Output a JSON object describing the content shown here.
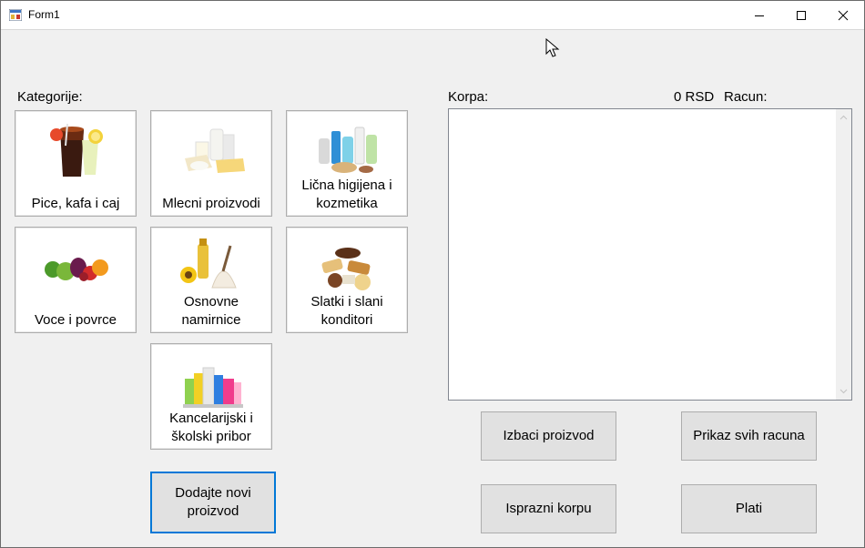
{
  "window": {
    "title": "Form1"
  },
  "categories_label": "Kategorije:",
  "categories": [
    {
      "label": "Pice, kafa i caj",
      "icon": "drinks-image"
    },
    {
      "label": "Mlecni proizvodi",
      "icon": "dairy-image"
    },
    {
      "label": "Lična higijena i kozmetika",
      "icon": "cosmetics-image"
    },
    {
      "label": "Voce i povrce",
      "icon": "fruit-vegetables-image"
    },
    {
      "label": "Osnovne namirnice",
      "icon": "groceries-image"
    },
    {
      "label": "Slatki i slani konditori",
      "icon": "sweets-image"
    },
    {
      "label": "Kancelarijski i školski pribor",
      "icon": "stationery-image"
    }
  ],
  "add_product_button": "Dodajte novi proizvod",
  "cart": {
    "label": "Korpa:",
    "total": "0 RSD",
    "bill_label": "Racun:",
    "items": []
  },
  "buttons": {
    "remove_product": "Izbaci proizvod",
    "show_all_bills": "Prikaz svih racuna",
    "empty_cart": "Isprazni korpu",
    "pay": "Plati"
  },
  "colors": {
    "focus_border": "#0078d7",
    "button_face": "#e1e1e1",
    "form_bg": "#f0f0f0"
  }
}
